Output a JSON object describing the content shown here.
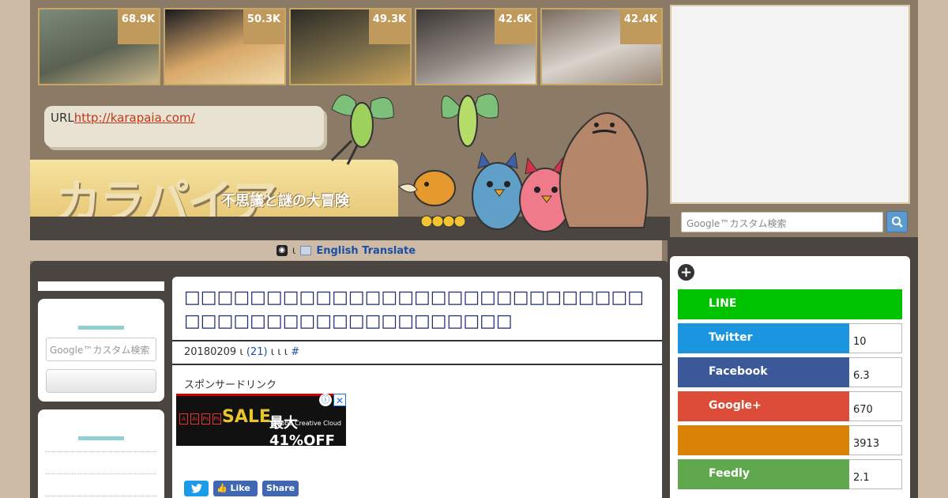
{
  "thumbnails": [
    {
      "count": "68.9K",
      "colors": [
        "#7d8a7a",
        "#5a6152",
        "#c9b78a"
      ]
    },
    {
      "count": "50.3K",
      "colors": [
        "#1a1a22",
        "#d8a868",
        "#f0d8a8"
      ]
    },
    {
      "count": "49.3K",
      "colors": [
        "#2b2a24",
        "#776a48",
        "#c9a35a"
      ]
    },
    {
      "count": "42.6K",
      "colors": [
        "#3a3634",
        "#8f8680",
        "#e6e1dc"
      ]
    },
    {
      "count": "42.4K",
      "colors": [
        "#7b6b5e",
        "#d9d3cc",
        "#9a8a78"
      ]
    }
  ],
  "header": {
    "url_label": "URL",
    "url_link": "http://karapaia.com/",
    "logo_text": "カラパイア",
    "tagline": "不思議と謎の大冒険"
  },
  "translate": {
    "sep": "ι",
    "label": "English Translate"
  },
  "left_sidebar": {
    "search_placeholder": "Google™カスタム検索"
  },
  "article": {
    "title": "□□□□□□□□□□□□□□□□□□□□□□□□□□□□□□□□□□□□□□□□□□□□□□□□",
    "date": "20180209",
    "comment_prefix": "ι",
    "comment_count": "(21)",
    "meta_rest": "ι ι    ι",
    "hash": "#",
    "sponsored": "スポンサードリンク",
    "ad": {
      "sale": "SALE",
      "percent": "最大41%OFF",
      "brand": "Adobe Creative Cloud",
      "close": "✕",
      "info": "ⓘ",
      "icons": [
        "A",
        "Ai",
        "Ps",
        "Ps"
      ]
    },
    "share": {
      "tweet": "",
      "like": "Like",
      "share": "Share"
    }
  },
  "right_sidebar": {
    "search_placeholder": "Google™カスタム検索",
    "search_icon": "magnifier-icon",
    "share_buttons": [
      {
        "label": "LINE",
        "count": "",
        "color": "#00c300"
      },
      {
        "label": "Twitter",
        "count": "10",
        "color": "#1b95e0"
      },
      {
        "label": "Facebook",
        "count": "6.3",
        "color": "#3b5998"
      },
      {
        "label": "Google+",
        "count": "670",
        "color": "#dd4b39"
      },
      {
        "label": "",
        "count": "3913",
        "color": "#da8107"
      },
      {
        "label": "Feedly",
        "count": "2.1",
        "color": "#5fa84d"
      }
    ]
  }
}
